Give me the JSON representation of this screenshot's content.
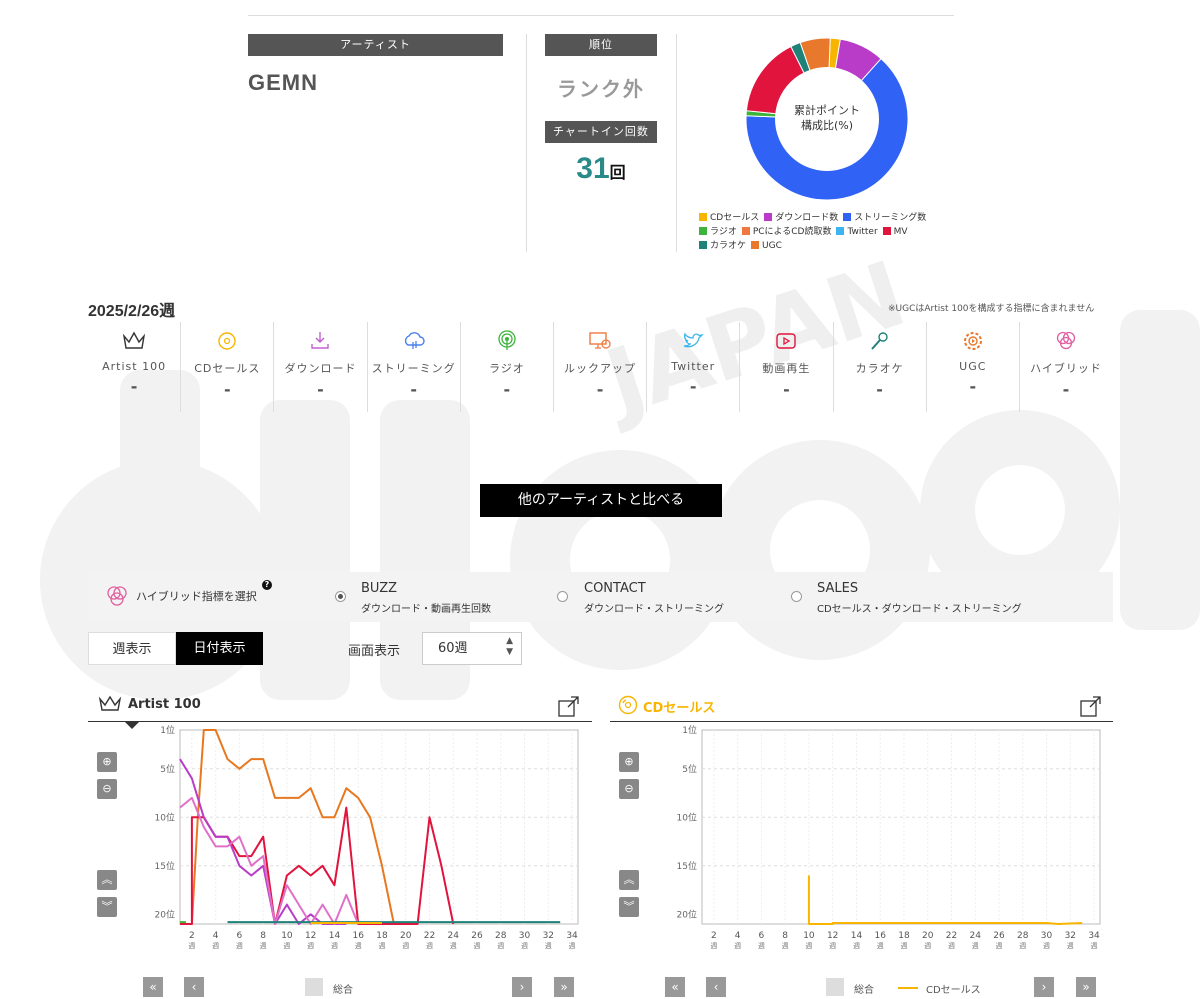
{
  "artist": {
    "label": "アーティスト",
    "name": "GEMN"
  },
  "rank": {
    "label": "順位",
    "value": "ランク外"
  },
  "chart_in": {
    "label": "チャートイン回数",
    "count": "31",
    "unit": "回"
  },
  "donut": {
    "center_line1": "累計ポイント",
    "center_line2": "構成比(%)",
    "legend": [
      {
        "label": "CDセールス",
        "color": "#f8b500"
      },
      {
        "label": "ダウンロード数",
        "color": "#b83cc8"
      },
      {
        "label": "ストリーミング数",
        "color": "#2f62f5"
      },
      {
        "label": "ラジオ",
        "color": "#3cb43c"
      },
      {
        "label": "PCによるCD読取数",
        "color": "#f07840"
      },
      {
        "label": "Twitter",
        "color": "#3cb4f0"
      },
      {
        "label": "MV",
        "color": "#e0143c"
      },
      {
        "label": "カラオケ",
        "color": "#1e8278"
      },
      {
        "label": "UGC",
        "color": "#e8782c"
      }
    ],
    "slices": [
      {
        "label": "CDセールス",
        "percent": 2,
        "color": "#f8b500"
      },
      {
        "label": "ダウンロード数",
        "percent": 9,
        "color": "#b83cc8"
      },
      {
        "label": "ストリーミング数",
        "percent": 64,
        "color": "#2f62f5"
      },
      {
        "label": "ラジオ",
        "percent": 1,
        "color": "#3cb43c"
      },
      {
        "label": "MV",
        "percent": 16,
        "color": "#e0143c"
      },
      {
        "label": "カラオケ",
        "percent": 2,
        "color": "#1e8278"
      },
      {
        "label": "UGC",
        "percent": 6,
        "color": "#e8782c"
      }
    ]
  },
  "week": {
    "title": "2025/2/26週",
    "note": "※UGCはArtist 100を構成する指標に含まれません"
  },
  "metrics": [
    {
      "label": "Artist 100",
      "value": "-",
      "icon": "crown-icon",
      "color": "#333"
    },
    {
      "label": "CDセールス",
      "value": "-",
      "icon": "cd-icon",
      "color": "#f8b500"
    },
    {
      "label": "ダウンロード",
      "value": "-",
      "icon": "download-icon",
      "color": "#c060d0"
    },
    {
      "label": "ストリーミング",
      "value": "-",
      "icon": "streaming-icon",
      "color": "#4a80f0"
    },
    {
      "label": "ラジオ",
      "value": "-",
      "icon": "radio-icon",
      "color": "#3cb43c"
    },
    {
      "label": "ルックアップ",
      "value": "-",
      "icon": "lookup-icon",
      "color": "#f07840"
    },
    {
      "label": "Twitter",
      "value": "-",
      "icon": "twitter-icon",
      "color": "#3cb4f0"
    },
    {
      "label": "動画再生",
      "value": "-",
      "icon": "video-icon",
      "color": "#e0143c"
    },
    {
      "label": "カラオケ",
      "value": "-",
      "icon": "karaoke-icon",
      "color": "#1e8278"
    },
    {
      "label": "UGC",
      "value": "-",
      "icon": "ugc-icon",
      "color": "#e8782c"
    },
    {
      "label": "ハイブリッド",
      "value": "-",
      "icon": "hybrid-icon",
      "color": "#e060a0"
    }
  ],
  "compare_button": "他のアーティストと比べる",
  "hybrid": {
    "label": "ハイブリッド指標を選択",
    "help": "?",
    "options": [
      {
        "title": "BUZZ",
        "sub": "ダウンロード・動画再生回数",
        "selected": true
      },
      {
        "title": "CONTACT",
        "sub": "ダウンロード・ストリーミング",
        "selected": false
      },
      {
        "title": "SALES",
        "sub": "CDセールス・ダウンロード・ストリーミング",
        "selected": false
      }
    ]
  },
  "view_toggle": {
    "weekly": "週表示",
    "daily": "日付表示"
  },
  "display": {
    "label": "画面表示",
    "selected": "60週"
  },
  "panels": {
    "artist100": {
      "title": "Artist 100",
      "legend_total": "総合"
    },
    "cd": {
      "title": "CDセールス",
      "legend_total": "総合",
      "legend_series": "CDセールス"
    }
  },
  "chart_data": [
    {
      "type": "line",
      "title": "Artist 100",
      "y_ticks": [
        "1位",
        "5位",
        "10位",
        "15位",
        "20位"
      ],
      "ylim": [
        1,
        21
      ],
      "y_inverted": true,
      "x_ticks": [
        "2週",
        "4週",
        "6週",
        "8週",
        "10週",
        "12週",
        "14週",
        "16週",
        "18週",
        "20週",
        "22週",
        "24週",
        "26週",
        "28週",
        "30週",
        "32週",
        "34週"
      ],
      "xlim": [
        1,
        34.5
      ],
      "series": [
        {
          "color": "#e87820",
          "points": [
            [
              1,
              21
            ],
            [
              2,
              21
            ],
            [
              2.5,
              10
            ],
            [
              3,
              1
            ],
            [
              4,
              1
            ],
            [
              5,
              4
            ],
            [
              6,
              5
            ],
            [
              7,
              4
            ],
            [
              8,
              4
            ],
            [
              9,
              8
            ],
            [
              10,
              8
            ],
            [
              11,
              8
            ],
            [
              12,
              7
            ],
            [
              13,
              10
            ],
            [
              14,
              10
            ],
            [
              15,
              7
            ],
            [
              16,
              8
            ],
            [
              17,
              10
            ],
            [
              18,
              15
            ],
            [
              19,
              21
            ]
          ]
        },
        {
          "color": "#e0143c",
          "points": [
            [
              1,
              21
            ],
            [
              2,
              21
            ],
            [
              2,
              10
            ],
            [
              3,
              10
            ],
            [
              4,
              12
            ],
            [
              5,
              12
            ],
            [
              6,
              14
            ],
            [
              7,
              14
            ],
            [
              8,
              12
            ],
            [
              9,
              21
            ],
            [
              10,
              16
            ],
            [
              11,
              15
            ],
            [
              12,
              16
            ],
            [
              13,
              15
            ],
            [
              14,
              17
            ],
            [
              15,
              9
            ],
            [
              16,
              21
            ],
            [
              17,
              21
            ],
            [
              20,
              21
            ],
            [
              21,
              21
            ],
            [
              22,
              10
            ],
            [
              23,
              15
            ],
            [
              24,
              21
            ]
          ]
        },
        {
          "color": "#b83cc8",
          "points": [
            [
              1,
              4
            ],
            [
              2,
              6
            ],
            [
              3,
              10
            ],
            [
              4,
              12
            ],
            [
              5,
              12
            ],
            [
              6,
              15
            ],
            [
              7,
              16
            ],
            [
              8,
              15
            ],
            [
              9,
              21
            ],
            [
              10,
              19
            ],
            [
              11,
              21
            ],
            [
              12,
              20
            ],
            [
              13,
              21
            ],
            [
              14,
              21
            ],
            [
              15,
              21
            ]
          ]
        },
        {
          "color": "#e070c8",
          "points": [
            [
              1,
              9
            ],
            [
              2,
              8
            ],
            [
              3,
              11
            ],
            [
              4,
              13
            ],
            [
              5,
              13
            ],
            [
              6,
              12
            ],
            [
              7,
              15
            ],
            [
              8,
              14
            ],
            [
              9,
              21
            ],
            [
              10,
              17
            ],
            [
              11,
              19
            ],
            [
              12,
              21
            ],
            [
              13,
              19
            ],
            [
              14,
              21
            ],
            [
              15,
              18
            ],
            [
              16,
              21
            ]
          ]
        },
        {
          "color": "#1e8278",
          "points": [
            [
              5,
              20.8
            ],
            [
              7,
              20.8
            ],
            [
              10,
              20.8
            ],
            [
              12,
              20.8
            ],
            [
              18,
              20.8
            ],
            [
              19,
              20.8
            ],
            [
              30,
              20.8
            ],
            [
              33,
              20.8
            ]
          ]
        },
        {
          "color": "#f8b500",
          "points": [
            [
              12,
              20.9
            ],
            [
              18,
              20.9
            ]
          ]
        },
        {
          "color": "#3cb43c",
          "points": [
            [
              1,
              20.8
            ],
            [
              1.5,
              20.8
            ]
          ]
        }
      ]
    },
    {
      "type": "line",
      "title": "CDセールス",
      "y_ticks": [
        "1位",
        "5位",
        "10位",
        "15位",
        "20位"
      ],
      "ylim": [
        1,
        21
      ],
      "y_inverted": true,
      "x_ticks": [
        "2週",
        "4週",
        "6週",
        "8週",
        "10週",
        "12週",
        "14週",
        "16週",
        "18週",
        "20週",
        "22週",
        "24週",
        "26週",
        "28週",
        "30週",
        "32週",
        "34週"
      ],
      "xlim": [
        1,
        34.5
      ],
      "series": [
        {
          "name": "CDセールス",
          "color": "#f8b500",
          "points": [
            [
              10,
              16
            ],
            [
              10,
              21
            ],
            [
              12,
              21
            ],
            [
              12,
              20.9
            ],
            [
              30,
              20.9
            ],
            [
              31,
              21
            ],
            [
              33,
              20.9
            ]
          ]
        }
      ]
    }
  ]
}
